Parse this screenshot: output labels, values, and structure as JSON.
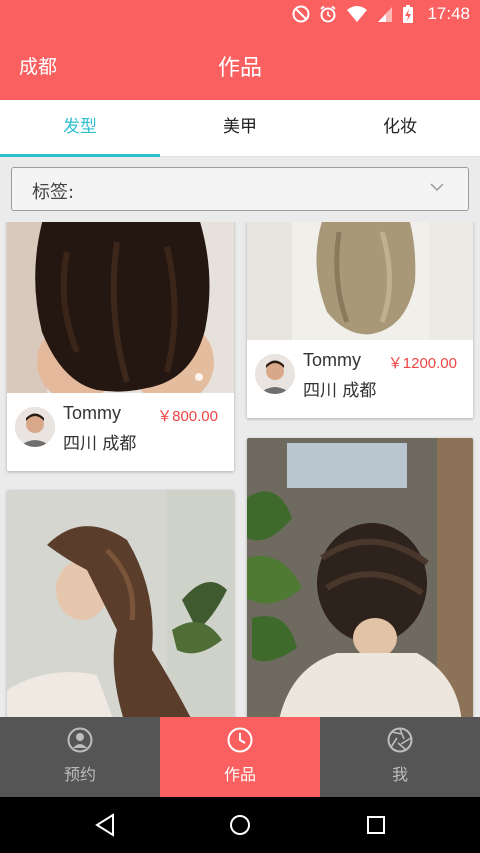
{
  "status_bar": {
    "time": "17:48",
    "icons": [
      "do-not-disturb-icon",
      "alarm-icon",
      "wifi-icon",
      "signal-icon",
      "battery-charging-icon"
    ]
  },
  "header": {
    "city": "成都",
    "title": "作品"
  },
  "tabs": [
    {
      "label": "发型",
      "active": true
    },
    {
      "label": "美甲",
      "active": false
    },
    {
      "label": "化妆",
      "active": false
    }
  ],
  "filter": {
    "label": "标签:"
  },
  "feed": {
    "cards": [
      {
        "stylist": "Tommy",
        "price": "￥800.00",
        "location": "四川 成都"
      },
      {
        "stylist": "Tommy",
        "price": "￥1200.00",
        "location": "四川 成都"
      },
      {
        "stylist": "",
        "price": "",
        "location": ""
      },
      {
        "stylist": "",
        "price": "",
        "location": ""
      }
    ]
  },
  "bottom_nav": [
    {
      "label": "预约",
      "icon": "person-icon",
      "active": false
    },
    {
      "label": "作品",
      "icon": "clock-icon",
      "active": true
    },
    {
      "label": "我",
      "icon": "aperture-icon",
      "active": false
    }
  ],
  "system_nav": [
    "back-icon",
    "home-icon",
    "recents-icon"
  ],
  "colors": {
    "brand": "#fb6061",
    "tab_active": "#2fbfcf",
    "price": "#ef4545",
    "nav_inactive": "#555555"
  }
}
